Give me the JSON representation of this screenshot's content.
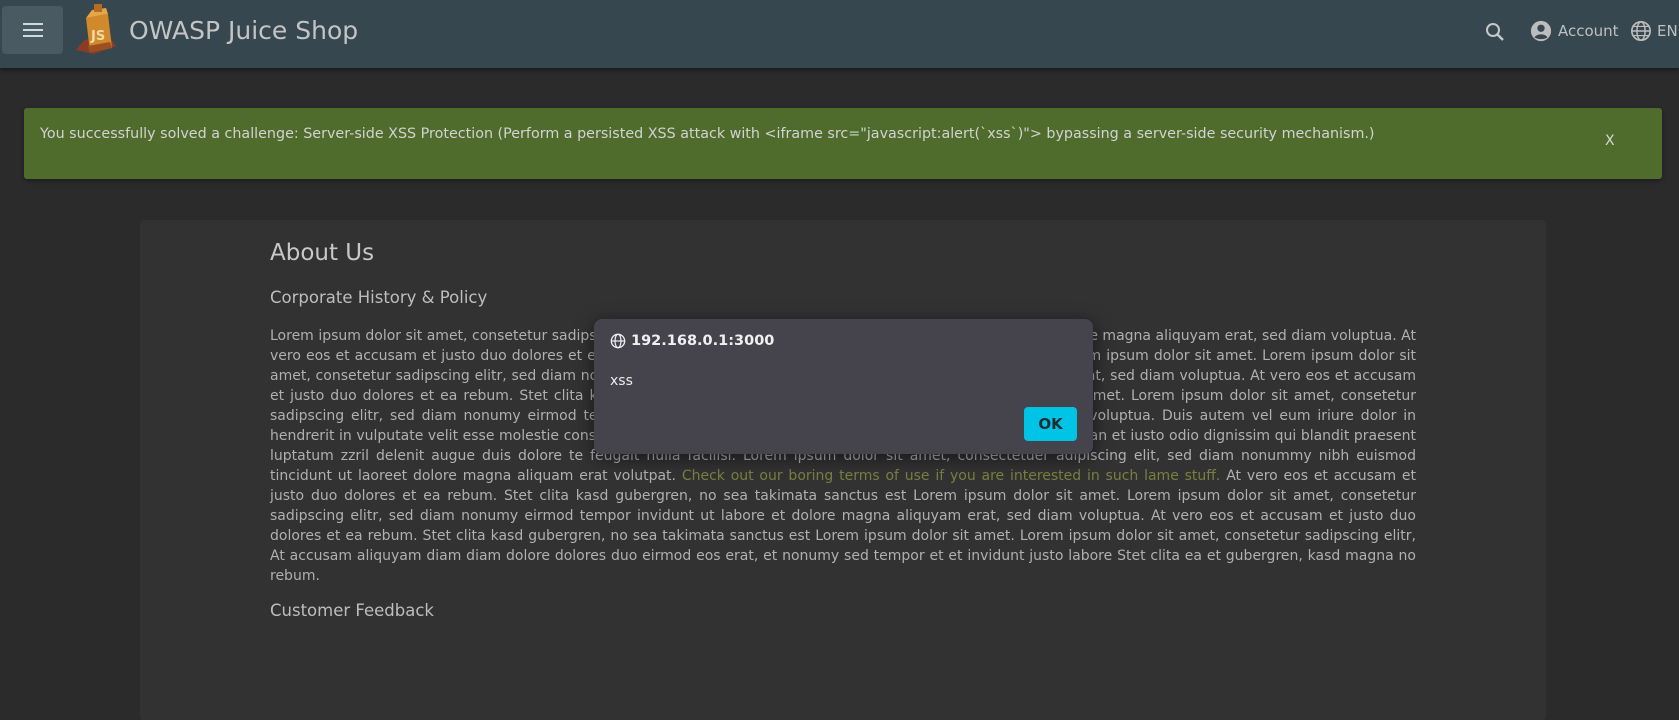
{
  "toolbar": {
    "title": "OWASP Juice Shop",
    "account_label": "Account",
    "language_label": "EN"
  },
  "banner": {
    "message": "You successfully solved a challenge: Server-side XSS Protection (Perform a persisted XSS attack with <iframe src=\"javascript:alert(`xss`)\"> bypassing a server-side security mechanism.)",
    "close_label": "X"
  },
  "about": {
    "title": "About Us",
    "subtitle": "Corporate History & Policy",
    "paragraph_start": "Lorem ipsum dolor sit amet, consetetur sadipscing elitr, sed diam nonumy eirmod tempor invidunt ut labore et dolore magna aliquyam erat, sed diam voluptua. At vero eos et accusam et justo duo dolores et ea rebum. Stet clita kasd gubergren, no sea takimata sanctus est Lorem ipsum dolor sit amet. Lorem ipsum dolor sit amet, consetetur sadipscing elitr, sed diam nonumy eirmod tempor invidunt ut labore et dolore magna aliquyam erat, sed diam voluptua. At vero eos et accusam et justo duo dolores et ea rebum. Stet clita kasd gubergren, no sea takimata sanctus est Lorem ipsum dolor sit amet. Lorem ipsum dolor sit amet, consetetur sadipscing elitr, sed diam nonumy eirmod tempor invidunt ut labore et dolore magna aliquyam erat, sed diam voluptua. Duis autem vel eum iriure dolor in hendrerit in vulputate velit esse molestie consequat, vel illum dolore eu feugiat nulla facilisis at vero eros et accumsan et iusto odio dignissim qui blandit praesent luptatum zzril delenit augue duis dolore te feugait nulla facilisi. Lorem ipsum dolor sit amet, consectetuer adipiscing elit, sed diam nonummy nibh euismod tincidunt ut laoreet dolore magna aliquam erat volutpat.",
    "terms_link": "Check out our boring terms of use if you are interested in such lame stuff.",
    "paragraph_end": "At vero eos et accusam et justo duo dolores et ea rebum. Stet clita kasd gubergren, no sea takimata sanctus est Lorem ipsum dolor sit amet. Lorem ipsum dolor sit amet, consetetur sadipscing elitr, sed diam nonumy eirmod tempor invidunt ut labore et dolore magna aliquyam erat, sed diam voluptua. At vero eos et accusam et justo duo dolores et ea rebum. Stet clita kasd gubergren, no sea takimata sanctus est Lorem ipsum dolor sit amet. Lorem ipsum dolor sit amet, consetetur sadipscing elitr, At accusam aliquyam diam diam dolore dolores duo eirmod eos erat, et nonumy sed tempor et et invidunt justo labore Stet clita ea et gubergren, kasd magna no rebum.",
    "feedback_heading": "Customer Feedback"
  },
  "dialog": {
    "origin": "192.168.0.1:3000",
    "message": "xss",
    "ok_label": "OK"
  },
  "colors": {
    "toolbar": "#37474f",
    "banner": "#4f6c2d",
    "ok_button": "#00c4e6",
    "link": "#79803f"
  },
  "icons": [
    "menu-icon",
    "juice-shop-logo",
    "search-icon",
    "account-circle-icon",
    "globe-icon"
  ]
}
